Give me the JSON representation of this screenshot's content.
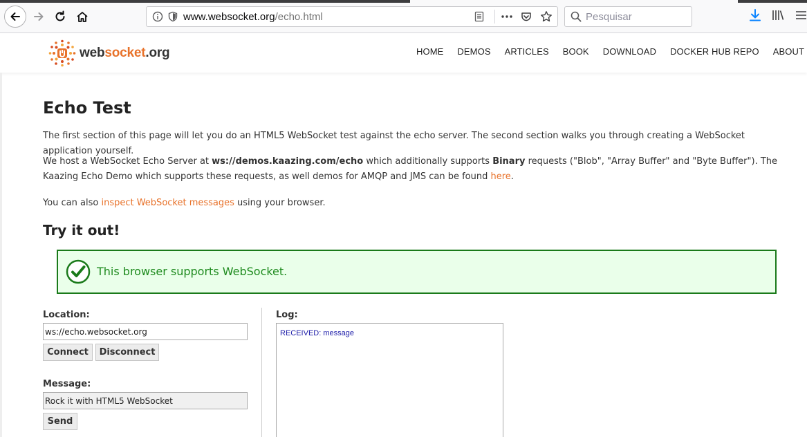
{
  "browser": {
    "url_host": "www.websocket.org",
    "url_path": "/echo.html",
    "search_placeholder": "Pesquisar"
  },
  "site": {
    "logo": {
      "part1": "web",
      "part2": "socket",
      "part3": ".org"
    },
    "nav": [
      "HOME",
      "DEMOS",
      "ARTICLES",
      "BOOK",
      "DOWNLOAD",
      "DOCKER HUB REPO",
      "ABOUT"
    ]
  },
  "page": {
    "title": "Echo Test",
    "intro": "The first section of this page will let you do an HTML5 WebSocket test against the echo server. The second section walks you through creating a WebSocket application yourself.",
    "p2": {
      "a": "We host a WebSocket Echo Server at ",
      "server": "ws://demos.kaazing.com/echo",
      "b": " which additionally supports ",
      "binary": "Binary",
      "c": " requests (\"Blob\", \"Array Buffer\" and \"Byte Buffer\"). The Kaazing Echo Demo which supports these requests, as well demos for AMQP and JMS can be found ",
      "here": "here",
      "d": "."
    },
    "p3": {
      "a": "You can also ",
      "link": "inspect WebSocket messages",
      "b": " using your browser."
    },
    "try_heading": "Try it out!",
    "support_message": "This browser supports WebSocket."
  },
  "form": {
    "location_label": "Location:",
    "location_value": "ws://echo.websocket.org",
    "connect_label": "Connect",
    "disconnect_label": "Disconnect",
    "message_label": "Message:",
    "message_value": "Rock it with HTML5 WebSocket",
    "send_label": "Send"
  },
  "log": {
    "label": "Log:",
    "entries": [
      "RECEIVED: message"
    ]
  },
  "colors": {
    "accent_orange": "#e8722a",
    "success_green": "#1d8a1d",
    "success_bg": "#eaffea",
    "log_blue": "#1a1aa8"
  }
}
